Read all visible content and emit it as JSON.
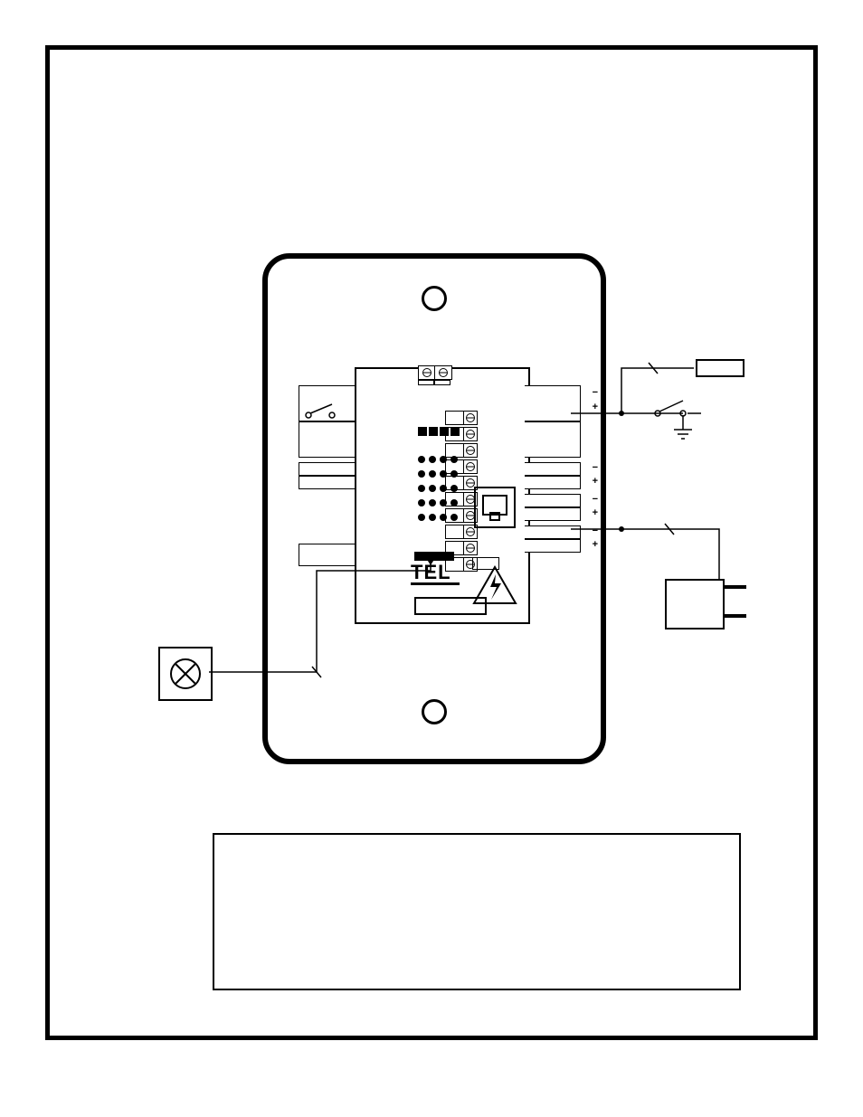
{
  "logo_text": "TEL",
  "terminals": {
    "right": [
      {
        "row": 1,
        "polarity": "−"
      },
      {
        "row": 2,
        "polarity": "+"
      },
      {
        "row": 3,
        "polarity": ""
      },
      {
        "row": 4,
        "polarity": ""
      },
      {
        "row": 5,
        "polarity": "−"
      },
      {
        "row": 6,
        "polarity": "+"
      },
      {
        "row": 7,
        "polarity": "−"
      },
      {
        "row": 8,
        "polarity": "+"
      },
      {
        "row": 9,
        "polarity": "−"
      },
      {
        "row": 10,
        "polarity": "+"
      }
    ]
  },
  "external": {
    "sensor": "sensor/lamp",
    "resistor": "resistor",
    "ac_adapter": "AC adapter",
    "switch": "contact switch"
  },
  "caption": ""
}
